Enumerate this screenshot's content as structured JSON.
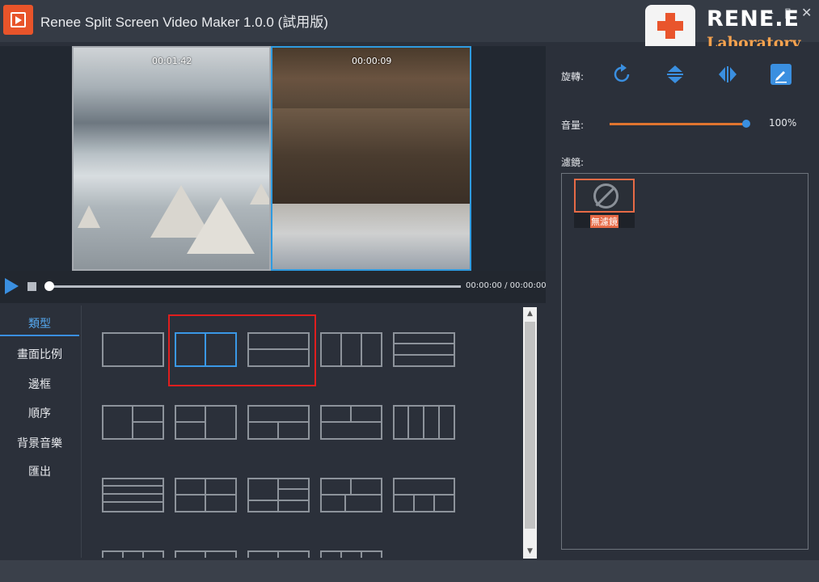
{
  "app": {
    "title": "Renee Split Screen Video Maker 1.0.0 (試用版)",
    "logo_brand": "RENE.E",
    "logo_sub": "Laboratory",
    "minimize_glyph": "–",
    "maximize_glyph": "▯",
    "close_glyph": "✕"
  },
  "preview": {
    "left_time": "00:01:42",
    "right_time": "00:00:09"
  },
  "player": {
    "time_readout": "00:00:00 / 00:00:00",
    "progress": 0
  },
  "nav": {
    "items": [
      {
        "label": "類型",
        "active": true
      },
      {
        "label": "畫面比例",
        "active": false
      },
      {
        "label": "邊框",
        "active": false
      },
      {
        "label": "順序",
        "active": false
      },
      {
        "label": "背景音樂",
        "active": false
      },
      {
        "label": "匯出",
        "active": false
      }
    ]
  },
  "layouts": {
    "selected_index": 1,
    "highlighted": [
      "split-2-vertical",
      "split-2-horizontal"
    ]
  },
  "scrollbar": {
    "up_glyph": "▲",
    "down_glyph": "▼"
  },
  "right": {
    "rotate_label": "旋轉:",
    "volume_label": "音量:",
    "volume_value": "100%",
    "volume_level": 1.0,
    "filter_label": "濾鏡:",
    "filters": [
      {
        "name": "無濾鏡",
        "selected": true
      }
    ],
    "icons": [
      "rotate-icon",
      "flip-vertical-icon",
      "flip-horizontal-icon",
      "edit-icon"
    ]
  },
  "colors": {
    "accent_blue": "#3a8fe0",
    "accent_orange": "#e66a46",
    "highlight_red": "#e01e1e"
  }
}
